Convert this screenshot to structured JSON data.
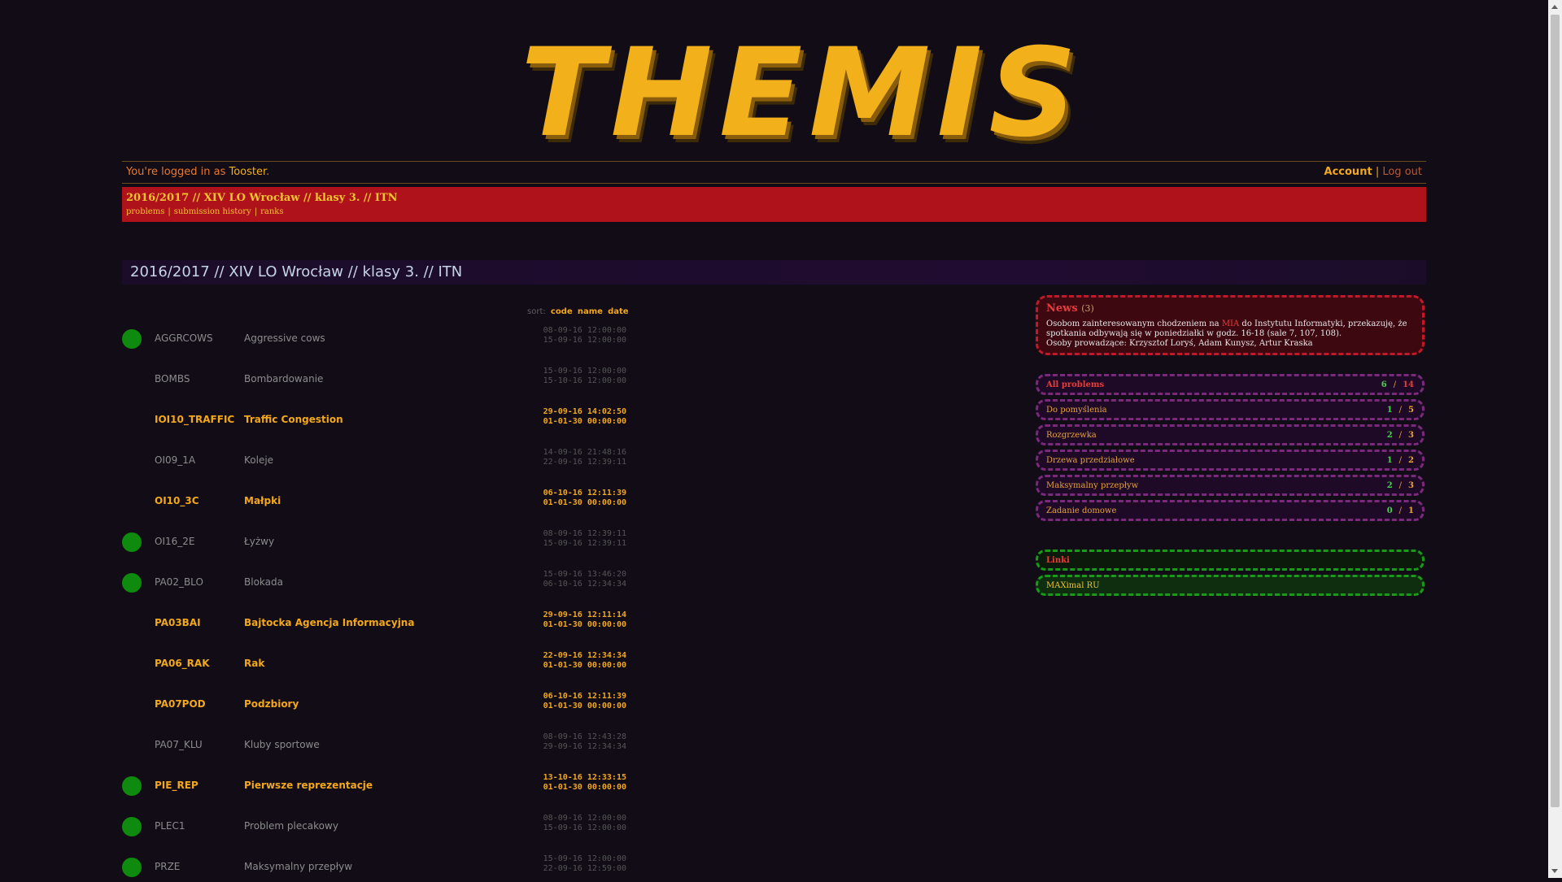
{
  "logo": {
    "text": "THEMIS"
  },
  "userbar": {
    "prefix": "You're logged in as ",
    "username": "Tooster",
    "suffix": ".",
    "account": "Account",
    "separator": "|",
    "logout": "Log out"
  },
  "contest": {
    "title": "2016/2017 // XIV LO Wrocław // klasy 3. // ITN",
    "links": [
      "problems",
      "submission history",
      "ranks"
    ]
  },
  "page_heading": "2016/2017 // XIV LO Wrocław // klasy 3. // ITN",
  "sort": {
    "label": "sort:",
    "options": [
      "code",
      "name",
      "date"
    ]
  },
  "problems": [
    {
      "code": "AGGRCOWS",
      "name": "Aggressive cows",
      "start": "08-09-16 12:00:00",
      "end": "15-09-16 12:00:00",
      "solved": true,
      "highlight": false
    },
    {
      "code": "BOMBS",
      "name": "Bombardowanie",
      "start": "15-09-16 12:00:00",
      "end": "15-10-16 12:00:00",
      "solved": false,
      "highlight": false
    },
    {
      "code": "IOI10_TRAFFIC",
      "name": "Traffic Congestion",
      "start": "29-09-16 14:02:50",
      "end": "01-01-30 00:00:00",
      "solved": false,
      "highlight": true
    },
    {
      "code": "OI09_1A",
      "name": "Koleje",
      "start": "14-09-16 21:48:16",
      "end": "22-09-16 12:39:11",
      "solved": false,
      "highlight": false
    },
    {
      "code": "OI10_3C",
      "name": "Małpki",
      "start": "06-10-16 12:11:39",
      "end": "01-01-30 00:00:00",
      "solved": false,
      "highlight": true
    },
    {
      "code": "OI16_2E",
      "name": "Łyżwy",
      "start": "08-09-16 12:39:11",
      "end": "15-09-16 12:39:11",
      "solved": true,
      "highlight": false
    },
    {
      "code": "PA02_BLO",
      "name": "Blokada",
      "start": "15-09-16 13:46:20",
      "end": "06-10-16 12:34:34",
      "solved": true,
      "highlight": false
    },
    {
      "code": "PA03BAI",
      "name": "Bajtocka Agencja Informacyjna",
      "start": "29-09-16 12:11:14",
      "end": "01-01-30 00:00:00",
      "solved": false,
      "highlight": true
    },
    {
      "code": "PA06_RAK",
      "name": "Rak",
      "start": "22-09-16 12:34:34",
      "end": "01-01-30 00:00:00",
      "solved": false,
      "highlight": true
    },
    {
      "code": "PA07POD",
      "name": "Podzbiory",
      "start": "06-10-16 12:11:39",
      "end": "01-01-30 00:00:00",
      "solved": false,
      "highlight": true
    },
    {
      "code": "PA07_KLU",
      "name": "Kluby sportowe",
      "start": "08-09-16 12:43:28",
      "end": "29-09-16 12:34:34",
      "solved": false,
      "highlight": false
    },
    {
      "code": "PIE_REP",
      "name": "Pierwsze reprezentacje",
      "start": "13-10-16 12:33:15",
      "end": "01-01-30 00:00:00",
      "solved": true,
      "highlight": true
    },
    {
      "code": "PLEC1",
      "name": "Problem plecakowy",
      "start": "08-09-16 12:00:00",
      "end": "15-09-16 12:00:00",
      "solved": true,
      "highlight": false
    },
    {
      "code": "PRZE",
      "name": "Maksymalny przepływ",
      "start": "15-09-16 12:00:00",
      "end": "22-09-16 12:59:00",
      "solved": true,
      "highlight": false
    }
  ],
  "news": {
    "title": "News",
    "count": "(3)",
    "body_before": "Osobom zainteresowanym chodzeniem na ",
    "body_link": "MIA",
    "body_after": " do Instytutu Informatyki, przekazuję, że spotkania odbywają się w poniedziałki w godz. 16-18 (sale 7, 107, 108).",
    "body_line2": "Osoby prowadzące: Krzysztof Loryś, Adam Kunysz, Artur Kraska"
  },
  "categories": [
    {
      "label": "All problems",
      "solved": "6",
      "total": "14",
      "all": true
    },
    {
      "label": "Do pomyślenia",
      "solved": "1",
      "total": "5",
      "all": false
    },
    {
      "label": "Rozgrzewka",
      "solved": "2",
      "total": "3",
      "all": false
    },
    {
      "label": "Drzewa przedziałowe",
      "solved": "1",
      "total": "2",
      "all": false
    },
    {
      "label": "Maksymalny przepływ",
      "solved": "2",
      "total": "3",
      "all": false
    },
    {
      "label": "Zadanie domowe",
      "solved": "0",
      "total": "1",
      "all": false
    }
  ],
  "links": {
    "title": "Linki",
    "items": [
      "MAXimal RU"
    ]
  },
  "colors": {
    "accent": "#f2a81a",
    "header_red": "#b0121c",
    "solved_green": "#0e8a0e",
    "background": "#120c17"
  }
}
